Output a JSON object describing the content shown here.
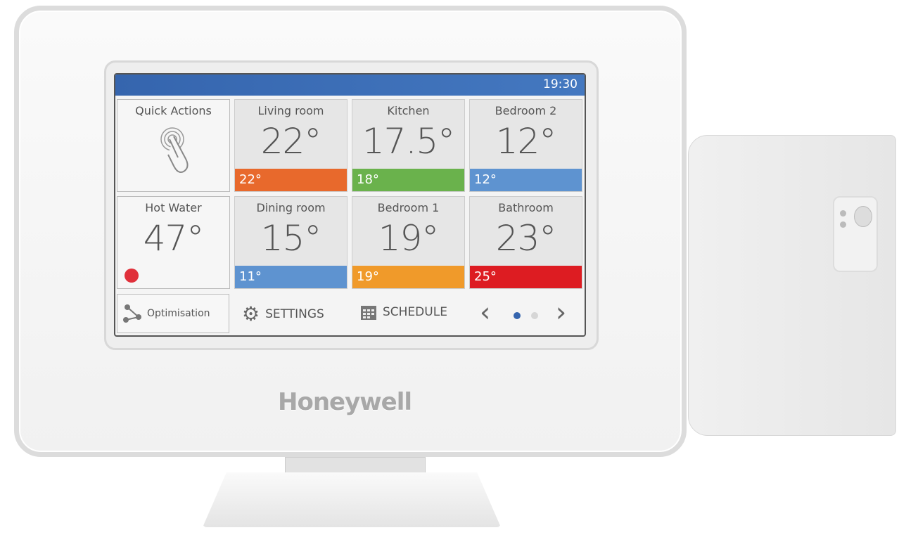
{
  "header": {
    "time": "19:30",
    "color": "#3a6db5"
  },
  "tiles": [
    {
      "name": "Quick Actions",
      "icon": "touch-hand-icon"
    },
    {
      "name": "Living room",
      "temp": "22°",
      "setpoint": "22°",
      "color": "#e8692c"
    },
    {
      "name": "Kitchen",
      "temp": "17.5°",
      "setpoint": "18°",
      "color": "#6ab24c"
    },
    {
      "name": "Bedroom 2",
      "temp": "12°",
      "setpoint": "12°",
      "color": "#5e93d0"
    },
    {
      "name": "Hot Water",
      "temp": "47°",
      "status_color": "#e0303a"
    },
    {
      "name": "Dining room",
      "temp": "15°",
      "setpoint": "11°",
      "color": "#5e93d0"
    },
    {
      "name": "Bedroom 1",
      "temp": "19°",
      "setpoint": "19°",
      "color": "#f09a2a"
    },
    {
      "name": "Bathroom",
      "temp": "23°",
      "setpoint": "25°",
      "color": "#dd1c22"
    }
  ],
  "bottom": {
    "optimisation": "Optimisation",
    "settings": "SETTINGS",
    "schedule": "SCHEDULE",
    "page": 1,
    "pages": 2
  },
  "brand": "Honeywell"
}
